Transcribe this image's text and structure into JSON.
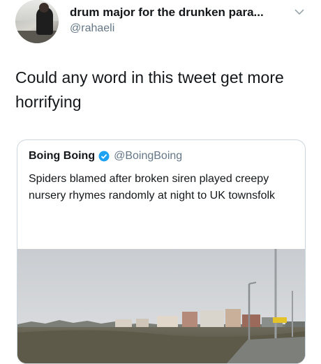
{
  "author": {
    "display_name": "drum major for the drunken para...",
    "handle": "@rahaeli",
    "avatar_icon": "profile-photo"
  },
  "tweet": {
    "text": "Could any word in this tweet get more horrifying"
  },
  "quoted_tweet": {
    "name": "Boing Boing",
    "handle": "@BoingBoing",
    "verified_icon": "verified-badge-icon",
    "text": "Spiders blamed after broken siren played creepy nursery rhymes randomly at night to UK townsfolk",
    "image_icon": "town-street-photo"
  },
  "colors": {
    "text_primary": "#14171a",
    "text_secondary": "#657786",
    "card_border": "#ccd6dd",
    "verified": "#1da1f2"
  }
}
